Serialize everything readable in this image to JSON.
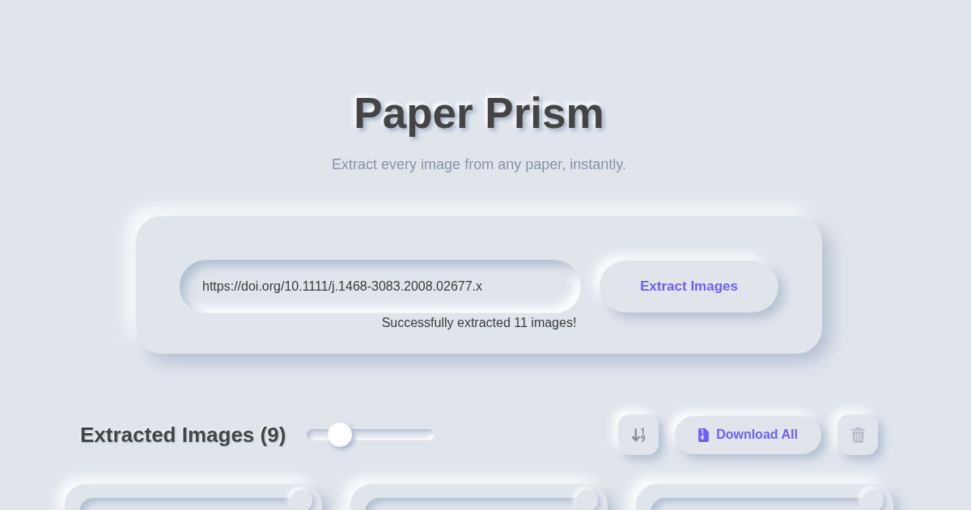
{
  "header": {
    "title": "Paper Prism",
    "subtitle": "Extract every image from any paper, instantly."
  },
  "extract_form": {
    "url_field": {
      "value": "https://doi.org/10.1111/j.1468-3083.2008.02677.x"
    },
    "submit_button": "Extract Images",
    "status": "Successfully extracted 11 images!"
  },
  "results": {
    "heading": "Extracted Images (9)",
    "size_slider": {
      "level": 0.2
    },
    "toolbar": [
      {
        "kind": "sort",
        "disabled": false
      },
      {
        "kind": "download",
        "label": "Download All",
        "disabled": false
      },
      {
        "kind": "delete",
        "disabled": true
      }
    ]
  },
  "image_cards": [
    {
      "kind": "image"
    },
    {
      "kind": "image"
    },
    {
      "kind": "image"
    }
  ]
}
